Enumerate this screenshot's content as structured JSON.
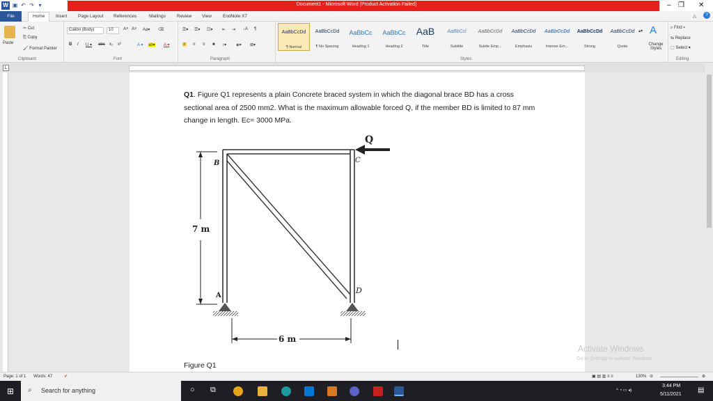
{
  "window": {
    "title": "Document1 - Microsoft Word (Product Activation Failed)",
    "minimize_glyph": "–",
    "restore_glyph": "❐",
    "close_glyph": "✕"
  },
  "tabs": [
    "File",
    "Home",
    "Insert",
    "Page Layout",
    "References",
    "Mailings",
    "Review",
    "View",
    "EndNote X7"
  ],
  "ribbon": {
    "clipboard": {
      "paste": "Paste",
      "cut": "Cut",
      "copy": "Copy",
      "format_painter": "Format Painter",
      "label": "Clipboard"
    },
    "font": {
      "name": "Calibri (Body)",
      "size": "10",
      "label": "Font"
    },
    "paragraph": {
      "label": "Paragraph"
    },
    "styles": {
      "label": "Styles",
      "items": [
        {
          "sample": "AaBbCcDd",
          "name": "¶ Normal"
        },
        {
          "sample": "AaBbCcDd",
          "name": "¶ No Spacing"
        },
        {
          "sample": "AaBbCc",
          "name": "Heading 1"
        },
        {
          "sample": "AaBbCc",
          "name": "Heading 2"
        },
        {
          "sample": "AaB",
          "name": "Title"
        },
        {
          "sample": "AaBbCcl",
          "name": "Subtitle"
        },
        {
          "sample": "AaBbCcDd",
          "name": "Subtle Emp..."
        },
        {
          "sample": "AaBbCcDd",
          "name": "Emphasis"
        },
        {
          "sample": "AaBbCcDd",
          "name": "Intense Em..."
        },
        {
          "sample": "AaBbCcDd",
          "name": "Strong"
        },
        {
          "sample": "AaBbCcDd",
          "name": "Quote"
        }
      ],
      "change_styles": "Change Styles"
    },
    "editing": {
      "find": "Find",
      "replace": "Replace",
      "select": "Select",
      "label": "Editing"
    }
  },
  "document": {
    "question_label": "Q1",
    "question_text": ". Figure Q1 represents a plain Concrete braced system in which the diagonal brace BD has a cross sectional area of 2500 mm2. What is the maximum allowable forced Q, if the member BD is limited to 87 mm change in length. Ec= 3000 MPa.",
    "figure": {
      "load_label": "Q",
      "node_b": "B",
      "node_c": "C",
      "node_a": "A",
      "node_d": "D",
      "height_label": "7 m",
      "width_label": "6 m"
    },
    "caption": "Figure Q1"
  },
  "watermark": {
    "line1": "Activate Windows",
    "line2": "Go to Settings to activate Windows."
  },
  "statusbar": {
    "page": "Page: 1 of 1",
    "words": "Words: 47",
    "zoom": "130%"
  },
  "taskbar": {
    "search_placeholder": "Search for anything",
    "time": "3:44 PM",
    "date": "5/11/2021"
  },
  "colors": {
    "title_red": "#e8201c",
    "word_blue": "#2b579a",
    "taskbar": "#1e1e24"
  }
}
